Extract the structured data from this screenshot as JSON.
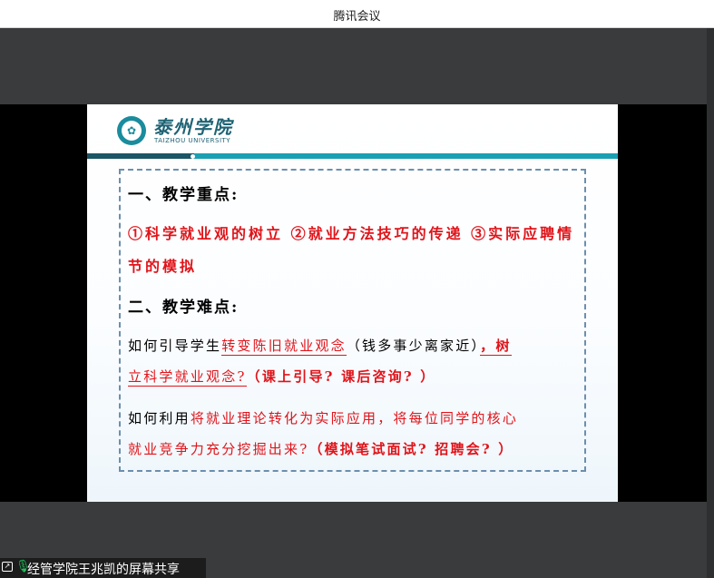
{
  "app": {
    "title": "腾讯会议"
  },
  "slide": {
    "logo": {
      "name_cn": "泰州学院",
      "name_en": "TAIZHOU UNIVERSITY"
    },
    "section1": {
      "heading": "一、教学重点:",
      "line1": "①科学就业观的树立 ②就业方法技巧的传递 ③实际应聘情",
      "line2": "节的模拟"
    },
    "section2": {
      "heading": "二、教学难点:",
      "p1": {
        "lead": "如何引导学生",
        "highlight": "转变陈旧就业观念",
        "paren": "（钱多事少离家近）",
        "tail": "，树",
        "line2_text": "立科学就业观念?",
        "line2_extra": "（课上引导? 课后咨询? ）"
      },
      "p2": {
        "lead": "如何利用",
        "highlight": "将就业理论转化为实际应用，将每位同学的核心",
        "line2_text": "就业竞争力充分挖掘出来?",
        "line2_extra": "（模拟笔试面试? 招聘会? ）"
      }
    }
  },
  "share_status": {
    "text": "经管学院王兆凯的屏幕共享"
  },
  "colors": {
    "accent_red": "#e0141a",
    "brand_teal": "#1aa0b2",
    "brand_dark": "#1b5566"
  }
}
